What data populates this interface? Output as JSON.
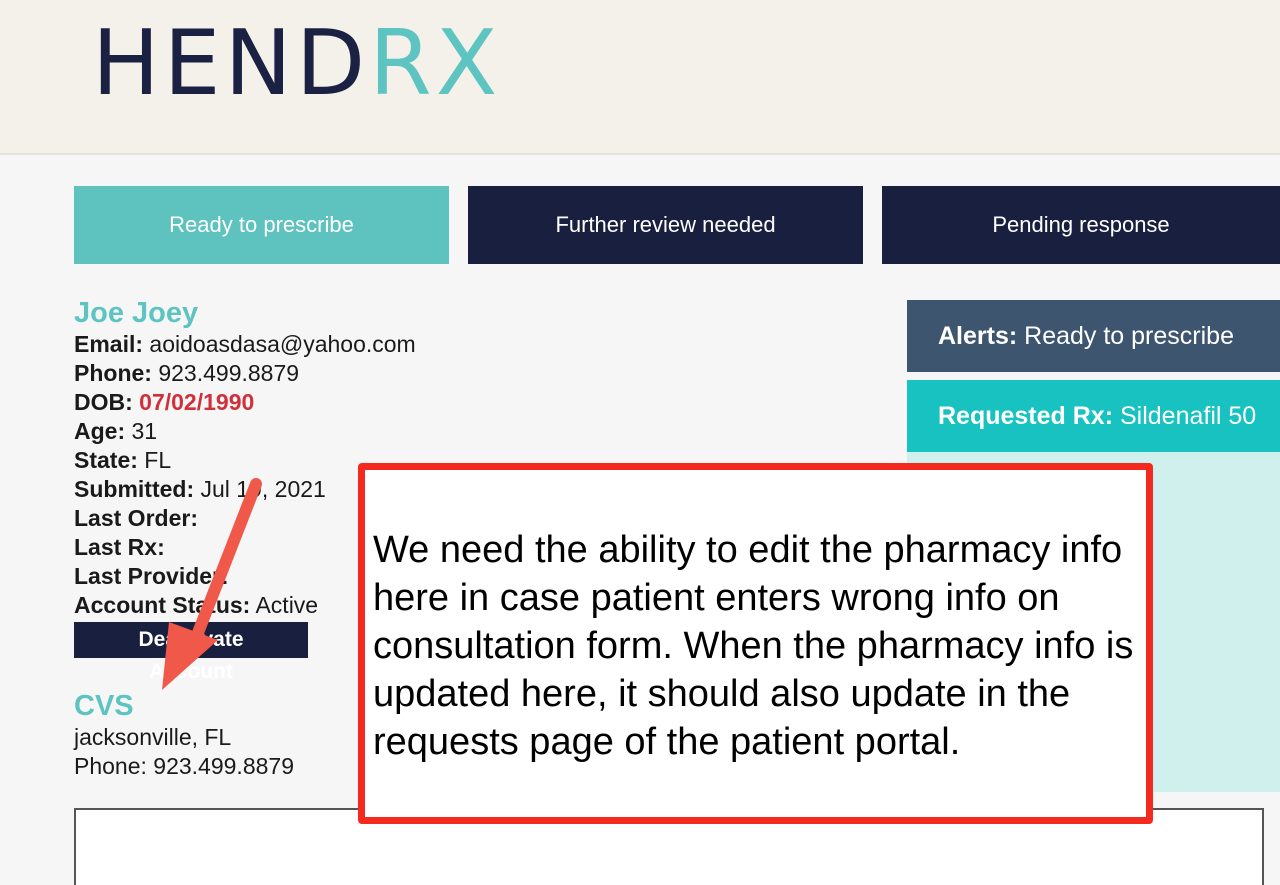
{
  "logo": {
    "part1": "HEND",
    "part2": "RX"
  },
  "tabs": [
    {
      "label": "Ready to prescribe"
    },
    {
      "label": "Further review needed"
    },
    {
      "label": "Pending response"
    }
  ],
  "patient": {
    "name": "Joe Joey",
    "email_label": "Email:",
    "email": "aoidoasdasa@yahoo.com",
    "phone_label": "Phone:",
    "phone": "923.499.8879",
    "dob_label": "DOB:",
    "dob": "07/02/1990",
    "age_label": "Age:",
    "age": "31",
    "state_label": "State:",
    "state": "FL",
    "submitted_label": "Submitted:",
    "submitted": "Jul 19, 2021",
    "last_order_label": "Last Order:",
    "last_rx_label": "Last Rx:",
    "last_provider_label": "Last Provider:",
    "account_status_label": "Account Status:",
    "account_status": "Active",
    "deactivate_label": "Deactivate Account"
  },
  "pharmacy": {
    "name": "CVS",
    "location": "jacksonville, FL",
    "phone": "Phone: 923.499.8879"
  },
  "alerts": {
    "label": "Alerts:",
    "value": "Ready to prescribe"
  },
  "requested": {
    "label": "Requested Rx:",
    "value": "Sildenafil 50"
  },
  "annotation": {
    "text": "We need the ability to edit the pharmacy info here in case patient enters wrong info on consultation form. When the pharmacy info is updated here, it should also update in the requests page of the patient portal."
  },
  "colors": {
    "navy": "#19203f",
    "teal": "#5ec2bf",
    "cyan": "#18c2c0",
    "slate": "#3e5570",
    "red": "#f42a1e",
    "dob_red": "#d0303a"
  }
}
